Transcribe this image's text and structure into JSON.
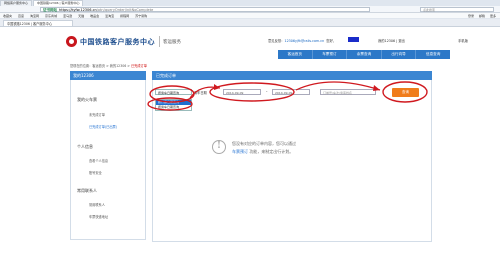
{
  "browser": {
    "tabs": [
      "网络客户服务中心",
      "中国铁路12306 | 客户服务中心"
    ],
    "address": {
      "secure": "证书网站",
      "host": "https://kyfw.12306.cn",
      "path": "/otn/queryOrder/initNoComplete"
    },
    "search_placeholder": "点此搜索",
    "bookmarks": [
      "收藏夹",
      "百度",
      "淘宝网",
      "京东商城",
      "亚马逊",
      "天猫",
      "唯品会",
      "爱淘宝",
      "携程网",
      "苏宁易购"
    ],
    "bookmarks_right": [
      "登录",
      "邮箱",
      "更多"
    ],
    "page_tab": "中国铁路12306 | 客户服务中心"
  },
  "site": {
    "logo_text": "中国铁路客户服务中心",
    "logo_sub": "客运服务",
    "user_prefix": "意见反馈：",
    "user_email": "12306yjfk@rails.com.cn",
    "user_greeting": "您好，",
    "my_account": "我的12306",
    "logout": "退出",
    "phone_version": "手机版",
    "nav": [
      "客运首页",
      "车票预订",
      "余票查询",
      "出行向导",
      "信息查询"
    ]
  },
  "breadcrumb": {
    "prefix": "您现在的位置：客运首页 > 我的12306 > ",
    "current": "已完成订单"
  },
  "sidebar": {
    "title": "我的12306",
    "groups": [
      {
        "label": "我的火车票",
        "items": [
          "未完成订单",
          "已完成订单(已出票)"
        ]
      },
      {
        "label": "个人信息",
        "items": [
          "查看个人信息",
          "账号安全"
        ]
      },
      {
        "label": "常用联系人",
        "items": [
          "常用联系人",
          "车票快递地址"
        ]
      }
    ]
  },
  "main": {
    "title": "已完成订单",
    "select_value": "按乘车日期查询",
    "dropdown_options": [
      "按订票日期查询",
      "按乘车日期查询"
    ],
    "date_label": "乘车日期",
    "date_from": "2014-09-09",
    "date_to": "2014-09-09",
    "order_placeholder": "订单号/车次/乘客姓名",
    "query_button": "查询",
    "empty_line1": "您没有对应的订单内容，您可以通过",
    "empty_link": "车票预订",
    "empty_line2_suffix": " 功能，来制定出行计划。"
  },
  "colors": {
    "nav_blue": "#2c78c8",
    "query_orange": "#f07c1b",
    "annotation_red": "#d0191f"
  }
}
